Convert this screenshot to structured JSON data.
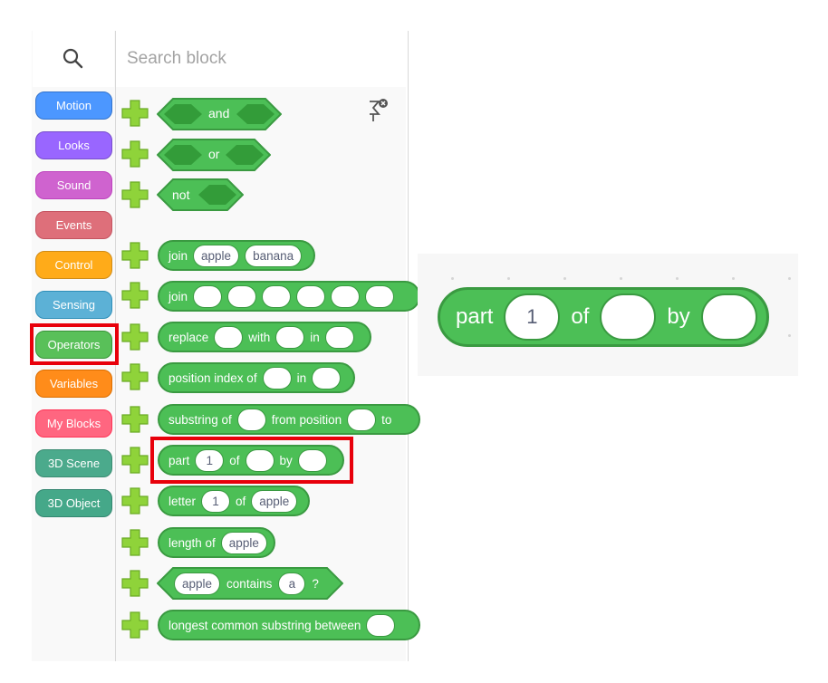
{
  "search": {
    "placeholder": "Search block"
  },
  "categories": [
    {
      "label": "Motion",
      "color": "#4c97ff",
      "border": "#3373cc"
    },
    {
      "label": "Looks",
      "color": "#9966ff",
      "border": "#774dcb"
    },
    {
      "label": "Sound",
      "color": "#cf63cf",
      "border": "#bd42bd"
    },
    {
      "label": "Events",
      "color": "#de6f7a",
      "border": "#c45360"
    },
    {
      "label": "Control",
      "color": "#ffab19",
      "border": "#cf8b17"
    },
    {
      "label": "Sensing",
      "color": "#5cb1d6",
      "border": "#2e8eb8"
    },
    {
      "label": "Operators",
      "color": "#59c059",
      "border": "#389438"
    },
    {
      "label": "Variables",
      "color": "#ff8c1a",
      "border": "#db6e00"
    },
    {
      "label": "My Blocks",
      "color": "#ff6680",
      "border": "#ff3355"
    },
    {
      "label": "3D Scene",
      "color": "#4baa8c",
      "border": "#3a8a71"
    },
    {
      "label": "3D Object",
      "color": "#45a889",
      "border": "#348570"
    }
  ],
  "blocks": {
    "and": "and",
    "or": "or",
    "not": "not",
    "join1": {
      "label": "join",
      "a": "apple",
      "b": "banana"
    },
    "join2": {
      "label": "join"
    },
    "replace": {
      "label": "replace",
      "with": "with",
      "in": "in"
    },
    "position": {
      "label": "position index of",
      "in": "in"
    },
    "substring": {
      "label": "substring of",
      "from": "from position",
      "to": "to"
    },
    "part": {
      "label": "part",
      "value": "1",
      "of": "of",
      "by": "by"
    },
    "letter": {
      "label": "letter",
      "value": "1",
      "of": "of",
      "text": "apple"
    },
    "length": {
      "label": "length of",
      "text": "apple"
    },
    "contains": {
      "text": "apple",
      "label": "contains",
      "value": "a",
      "q": "?"
    },
    "longest": {
      "label": "longest common substring between"
    }
  },
  "zoom": {
    "label": "part",
    "value": "1",
    "of": "of",
    "by": "by"
  }
}
